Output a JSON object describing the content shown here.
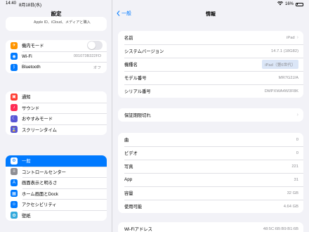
{
  "statusbar": {
    "time": "14:40",
    "date": "8月18日(水)",
    "battery": "16%"
  },
  "sidebar": {
    "title": "設定",
    "profile_text": "Apple ID、iCloud、メディアと購入",
    "groups": [
      [
        {
          "label": "機内モード",
          "icon": "airplane-icon",
          "color": "#ff9500",
          "toggle": true
        },
        {
          "label": "Wi-Fi",
          "icon": "wifi-icon",
          "color": "#007aff",
          "value": "001073B322FD"
        },
        {
          "label": "Bluetooth",
          "icon": "bluetooth-icon",
          "color": "#007aff",
          "value": "オフ"
        }
      ],
      [
        {
          "label": "通知",
          "icon": "notifications-icon",
          "color": "#ff3b30"
        },
        {
          "label": "サウンド",
          "icon": "sound-icon",
          "color": "#ff2d55"
        },
        {
          "label": "おやすみモード",
          "icon": "moon-icon",
          "color": "#5856d6"
        },
        {
          "label": "スクリーンタイム",
          "icon": "hourglass-icon",
          "color": "#5856d6"
        }
      ],
      [
        {
          "label": "一般",
          "icon": "gear-icon",
          "color": "#8e8e93",
          "selected": true
        },
        {
          "label": "コントロールセンター",
          "icon": "control-center-icon",
          "color": "#8e8e93"
        },
        {
          "label": "画面表示と明るさ",
          "icon": "display-icon",
          "color": "#007aff"
        },
        {
          "label": "ホーム画面とDock",
          "icon": "home-screen-icon",
          "color": "#007aff"
        },
        {
          "label": "アクセシビリティ",
          "icon": "accessibility-icon",
          "color": "#007aff"
        },
        {
          "label": "壁紙",
          "icon": "wallpaper-icon",
          "color": "#34aadc"
        }
      ]
    ]
  },
  "main": {
    "back_label": "一般",
    "title": "情報",
    "card1": [
      {
        "label": "名前",
        "value": "iPad",
        "chevron": true
      },
      {
        "label": "システムバージョン",
        "value": "14.7.1 (18G82)"
      },
      {
        "label": "機種名",
        "value": "iPad（第6世代）",
        "highlight": true
      },
      {
        "label": "モデル番号",
        "value": "MR7G2J/A"
      },
      {
        "label": "シリアル番号",
        "value": "DMPXWA4W3F8K"
      }
    ],
    "card2": [
      {
        "label": "保証期限切れ",
        "chevron": true
      }
    ],
    "card3": [
      {
        "label": "曲",
        "value": "0"
      },
      {
        "label": "ビデオ",
        "value": "0"
      },
      {
        "label": "写真",
        "value": "221"
      },
      {
        "label": "App",
        "value": "31"
      },
      {
        "label": "容量",
        "value": "32 GB"
      },
      {
        "label": "使用可能",
        "value": "4.64 GB"
      }
    ],
    "card4": [
      {
        "label": "Wi-Fiアドレス",
        "value": "48:5C:6B:B9:B1:6B"
      }
    ]
  }
}
